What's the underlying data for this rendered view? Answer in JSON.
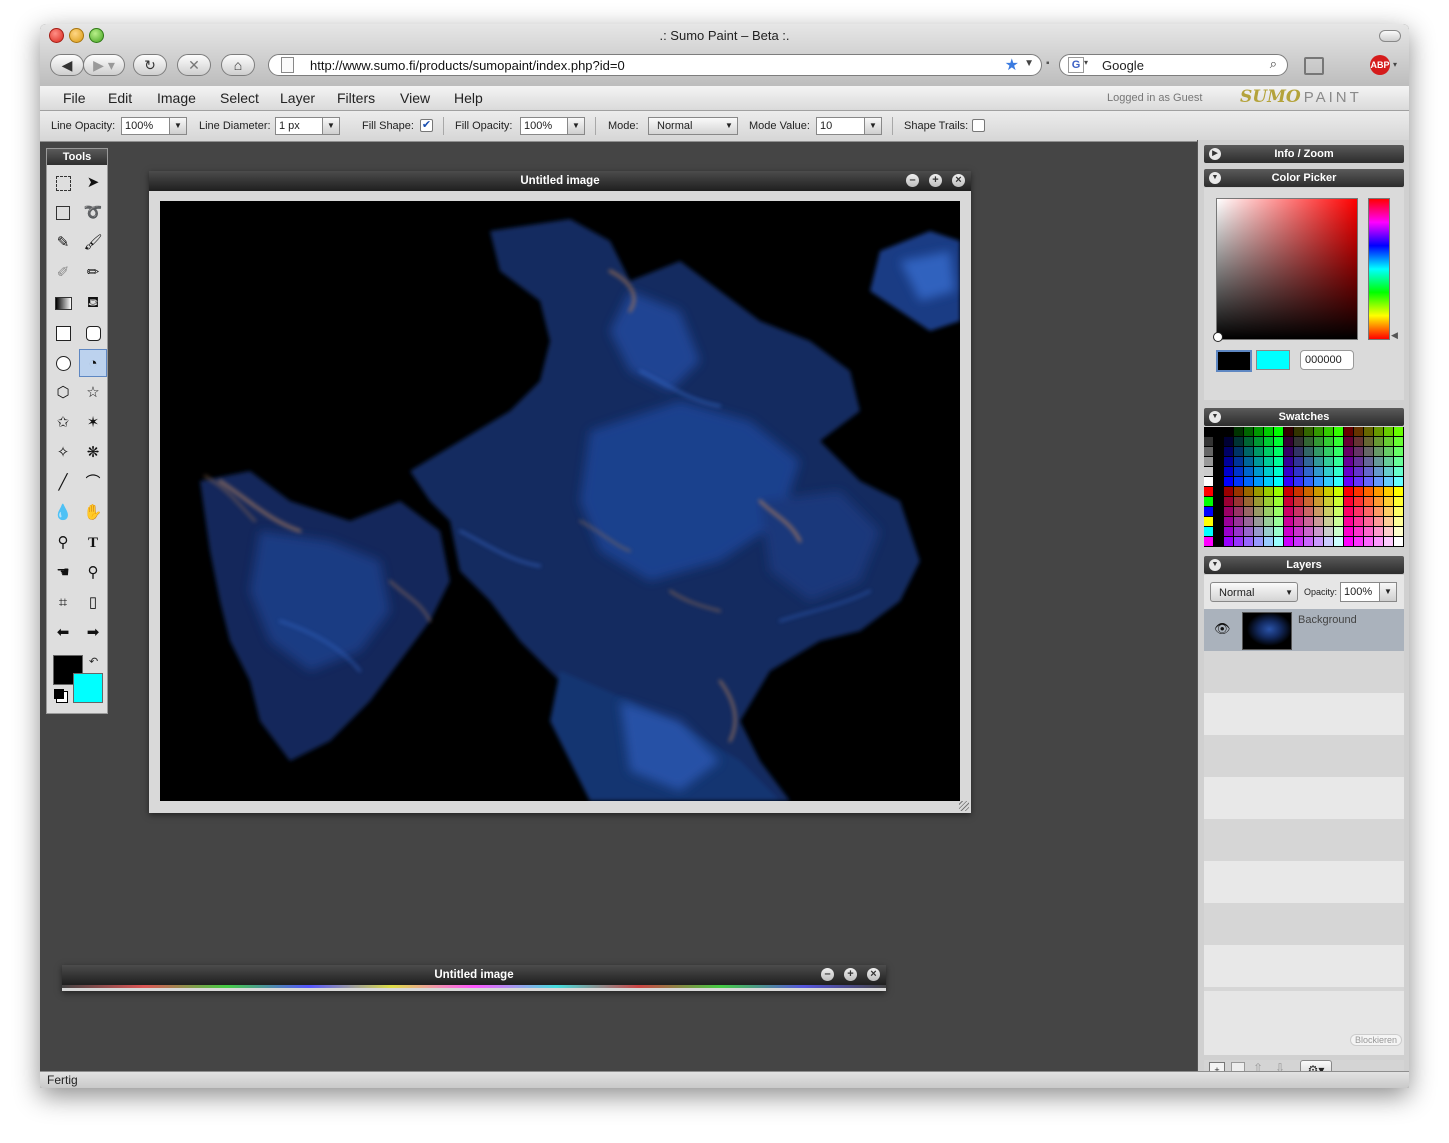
{
  "window": {
    "title": ".: Sumo Paint – Beta :."
  },
  "browser": {
    "url": "http://www.sumo.fi/products/sumopaint/index.php?id=0",
    "search_placeholder": "Google",
    "status": "Fertig"
  },
  "menu": {
    "items": [
      "File",
      "Edit",
      "Image",
      "Select",
      "Layer",
      "Filters",
      "View",
      "Help"
    ],
    "logged_in": "Logged in as Guest",
    "logo_word1": "SUMO",
    "logo_word2": "PAINT"
  },
  "options": {
    "line_opacity_label": "Line Opacity:",
    "line_opacity_value": "100%",
    "line_diameter_label": "Line Diameter:",
    "line_diameter_value": "1 px",
    "fill_shape_label": "Fill Shape:",
    "fill_shape_checked": true,
    "fill_opacity_label": "Fill Opacity:",
    "fill_opacity_value": "100%",
    "mode_label": "Mode:",
    "mode_value": "Normal",
    "mode_value_label": "Mode Value:",
    "mode_value_value": "10",
    "shape_trails_label": "Shape Trails:",
    "shape_trails_checked": false
  },
  "tools": {
    "title": "Tools",
    "foreground_color": "#000000",
    "background_color": "#00ffff"
  },
  "document": {
    "title": "Untitled image"
  },
  "document2": {
    "title": "Untitled image"
  },
  "panels": {
    "info_zoom": "Info / Zoom",
    "color_picker": "Color Picker",
    "color_hex": "000000",
    "swatches": "Swatches",
    "layers": "Layers",
    "layer_mode": "Normal",
    "opacity_label": "Opacity:",
    "opacity_value": "100%",
    "layer_name": "Background",
    "blockieren": "Blockieren"
  },
  "colors": {
    "accent": "#5e87c2",
    "canvas_bg": "#000000",
    "paint_blue": "#1b3f8c",
    "paint_orange": "#b97a52"
  }
}
